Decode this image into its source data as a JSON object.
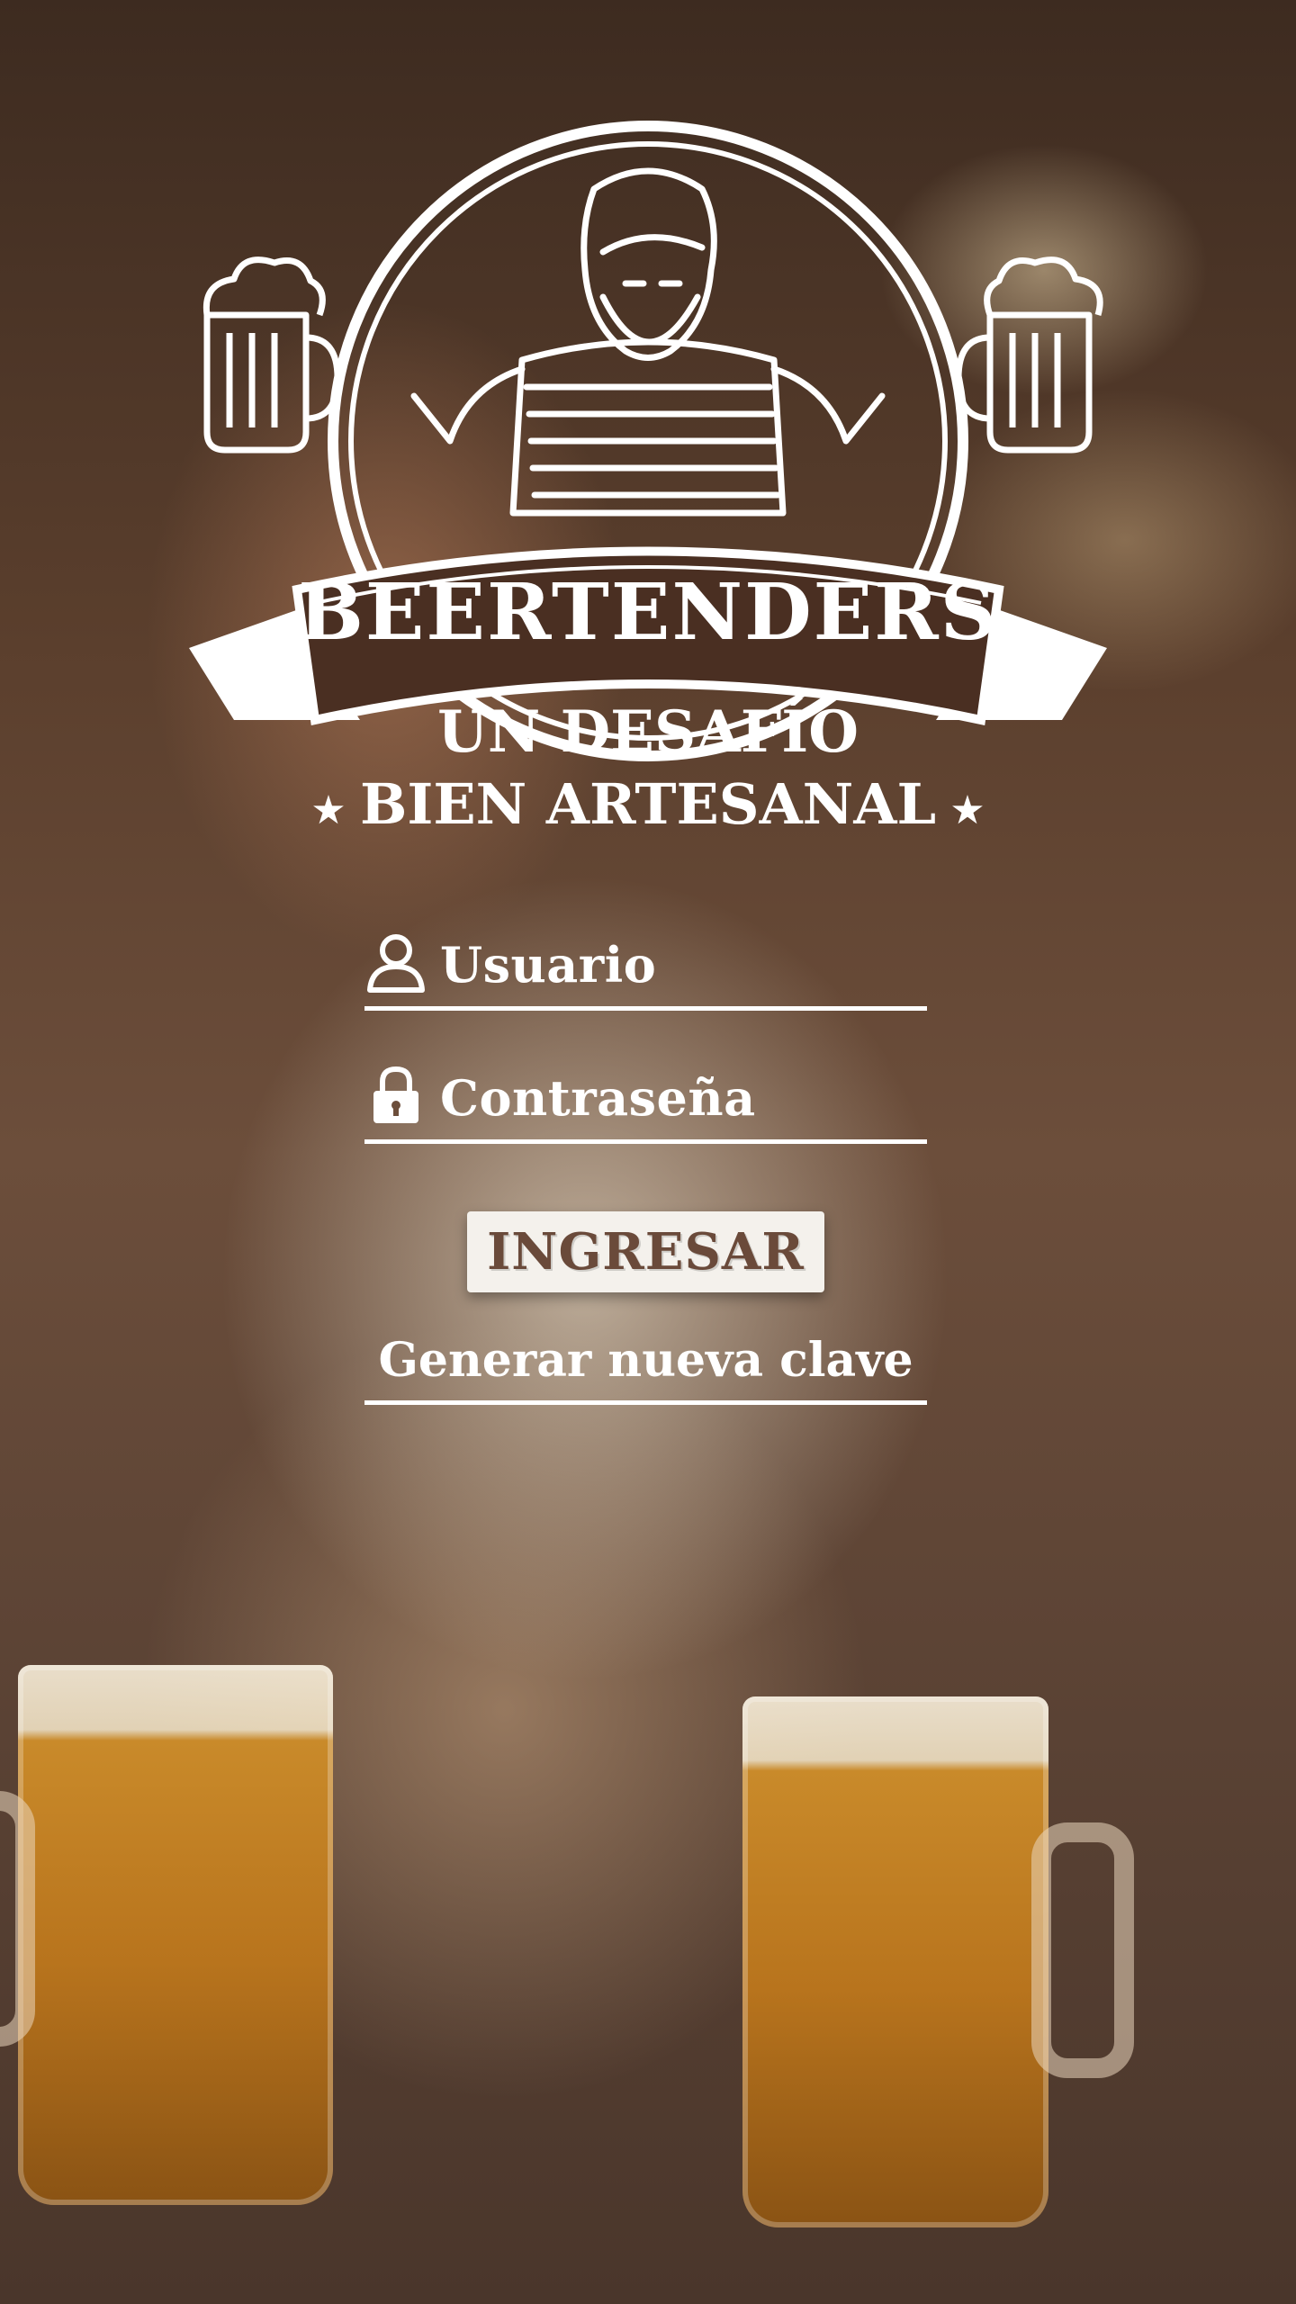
{
  "logo": {
    "brand": "BEERTENDERS",
    "tagline_line1": "UN DESAFÍO",
    "tagline_line2": "BIEN ARTESANAL"
  },
  "login": {
    "username_label": "Usuario",
    "password_label": "Contraseña",
    "submit_label": "INGRESAR",
    "reset_link": "Generar nueva clave"
  },
  "icons": {
    "username": "user-icon",
    "password": "lock-icon"
  },
  "colors": {
    "foreground": "#ffffff",
    "button_bg": "#f4f1ec",
    "button_text": "#6a4a3a"
  }
}
